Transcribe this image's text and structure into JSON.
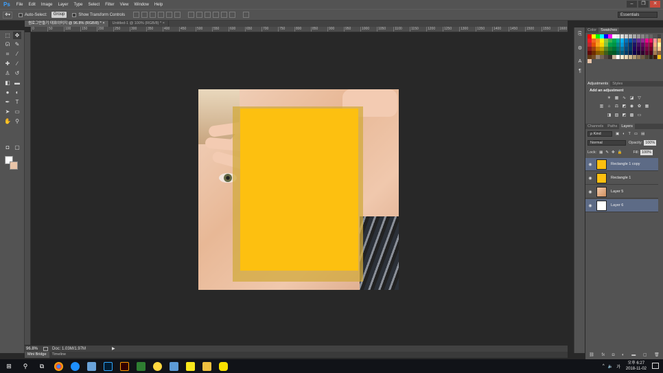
{
  "app": {
    "logo": "Ps"
  },
  "menu": [
    "File",
    "Edit",
    "Image",
    "Layer",
    "Type",
    "Select",
    "Filter",
    "View",
    "Window",
    "Help"
  ],
  "window_controls": {
    "minimize": "–",
    "restore": "❐",
    "close": "✕"
  },
  "options_bar": {
    "auto_select_label": "Auto-Select:",
    "auto_select_value": "Group",
    "show_transform_label": "Show Transform Controls",
    "workspace": "Essentials"
  },
  "doc_tabs": [
    {
      "label": "썸로그만들기 대표이미지 @ 96.8% (RGB/8) *",
      "close": "×"
    },
    {
      "label": "Untitled-1 @ 100% (RGB/8) *",
      "close": "×"
    }
  ],
  "ruler_top": [
    "0",
    "50",
    "100",
    "150",
    "200",
    "250",
    "300",
    "350",
    "400",
    "450",
    "500",
    "550",
    "600",
    "650",
    "700",
    "750",
    "800",
    "850",
    "900",
    "950",
    "1000",
    "1050",
    "1100",
    "1150",
    "1200",
    "1250",
    "1300",
    "1350",
    "1400",
    "1450",
    "1500",
    "1550",
    "1600"
  ],
  "status": {
    "zoom": "96.8%",
    "doc_info": "Doc: 1.03M/1.97M",
    "arrow": "▶"
  },
  "bottom_tabs": [
    "Mini Bridge",
    "Timeline"
  ],
  "panels": {
    "color_tabs": [
      "Color",
      "Swatches"
    ],
    "adjust_tabs": [
      "Adjustments",
      "Styles"
    ],
    "adjust_title": "Add an adjustment",
    "layer_tabs": [
      "Channels",
      "Paths",
      "Layers"
    ],
    "kind_label": "ρ Kind",
    "blend_mode": "Normal",
    "opacity_label": "Opacity:",
    "opacity_value": "100%",
    "lock_label": "Lock:",
    "fill_label": "Fill:",
    "fill_value": "100%",
    "layers": [
      {
        "name": "Rectangle 1 copy",
        "selected": true,
        "thumb_color": "#fdc010"
      },
      {
        "name": "Rectangle 1",
        "selected": false,
        "thumb_color": "#fdc010"
      },
      {
        "name": "Layer 5",
        "selected": false,
        "thumb_color": "#e9b88f"
      },
      {
        "name": "Layer 6",
        "selected": true,
        "thumb_color": "#ffffff"
      }
    ]
  },
  "swatch_colors": [
    "#ff0000",
    "#ffff00",
    "#00ff00",
    "#00ffff",
    "#0000ff",
    "#ff00ff",
    "#ffffff",
    "#eeeeee",
    "#dddddd",
    "#cccccc",
    "#bbbbbb",
    "#aaaaaa",
    "#999999",
    "#888888",
    "#777777",
    "#666666",
    "#555555",
    "#444444",
    "#ed1c24",
    "#f26522",
    "#f7941d",
    "#fff200",
    "#8dc63f",
    "#39b54a",
    "#00a651",
    "#00a99d",
    "#00aeef",
    "#0072bc",
    "#0054a6",
    "#2e3192",
    "#662d91",
    "#92278f",
    "#ec008c",
    "#ed145b",
    "#f5989d",
    "#fbaf5d",
    "#c1272d",
    "#e35205",
    "#f9a11b",
    "#ffd600",
    "#7ac143",
    "#00a14b",
    "#009444",
    "#008a8a",
    "#0098d8",
    "#005b9a",
    "#003471",
    "#1b1464",
    "#440e62",
    "#630460",
    "#9e005d",
    "#9e0039",
    "#f9ad81",
    "#fff799",
    "#8b1a1a",
    "#a0410d",
    "#c77c02",
    "#b8a400",
    "#598527",
    "#197b30",
    "#007236",
    "#00746b",
    "#0076a3",
    "#004a80",
    "#003663",
    "#21005d",
    "#32004b",
    "#4b0049",
    "#7b0046",
    "#7a0026",
    "#c69c6d",
    "#fdc68a",
    "#5e0b0b",
    "#6f2c00",
    "#8a5a00",
    "#7f6f00",
    "#3f5f1b",
    "#0b5a22",
    "#005826",
    "#005e56",
    "#00597a",
    "#003a66",
    "#002157",
    "#0d004c",
    "#1a0033",
    "#2e002f",
    "#5b002e",
    "#52001b",
    "#a67c52",
    "#8c6239",
    "#603913",
    "#754c24",
    "#998675",
    "#736357",
    "#534741",
    "#362f2d",
    "#c7b299",
    "#ffffff",
    "#f6e9d0",
    "#ecd9b6",
    "#d4bb93",
    "#b49a73",
    "#947a56",
    "#6f5b41",
    "#4c3f2e",
    "#2e2519",
    "#42210b",
    "#fdc010",
    "#e8c4a8"
  ],
  "taskbar": {
    "start_icon": "⊞",
    "search_icon": "⚲",
    "tray_arrow": "^",
    "volume": "🔈",
    "ime": "가",
    "time": "오후 6:27",
    "date": "2018-11-02"
  }
}
